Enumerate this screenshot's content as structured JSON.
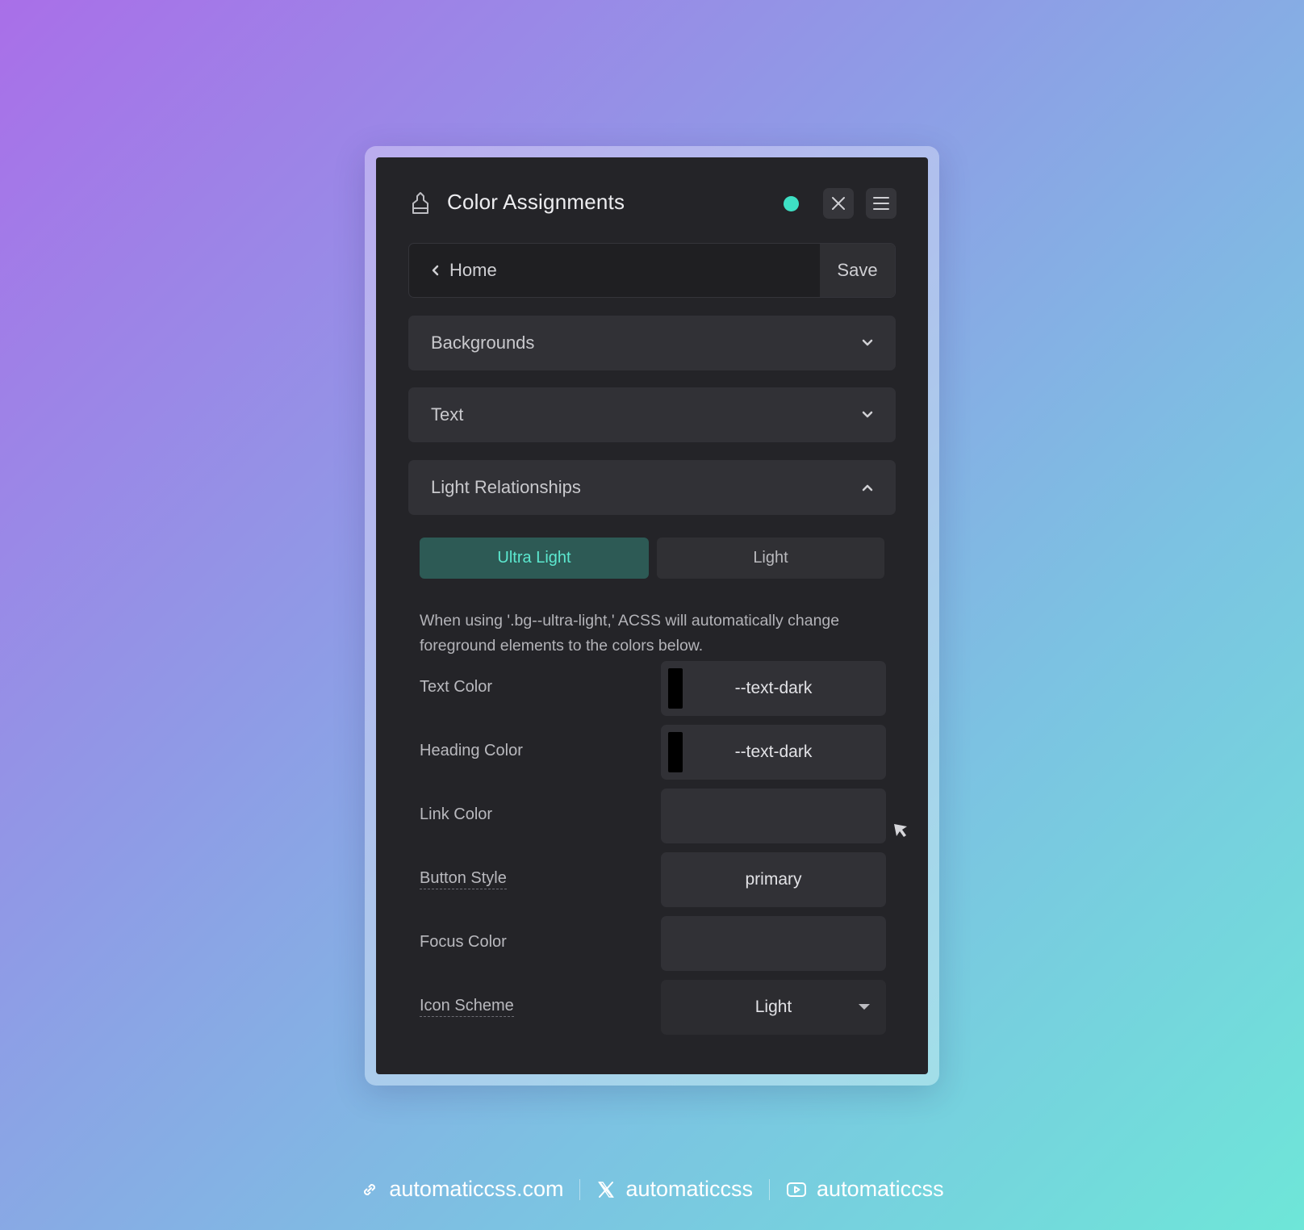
{
  "panel": {
    "title": "Color Assignments",
    "status_color": "#3ee0c4",
    "nav": {
      "back_label": "Home",
      "save_label": "Save"
    },
    "sections": [
      {
        "label": "Backgrounds",
        "state": "collapsed"
      },
      {
        "label": "Text",
        "state": "collapsed"
      },
      {
        "label": "Light Relationships",
        "state": "expanded"
      }
    ],
    "segments": {
      "active": "Ultra Light",
      "inactive": "Light"
    },
    "description": "When using '.bg--ultra-light,' ACSS will automatically change foreground elements to the colors below.",
    "rows": [
      {
        "label": "Text Color",
        "value": "--text-dark",
        "swatch": "#000000"
      },
      {
        "label": "Heading Color",
        "value": "--text-dark",
        "swatch": "#000000"
      },
      {
        "label": "Link Color",
        "value": ""
      },
      {
        "label": "Button Style",
        "value": "primary"
      },
      {
        "label": "Focus Color",
        "value": ""
      },
      {
        "label": "Icon Scheme",
        "value": "Light"
      }
    ]
  },
  "footer": {
    "website": "automaticcss.com",
    "x_handle": "automaticcss",
    "youtube_handle": "automaticcss"
  },
  "colors": {
    "accent": "#5ce8cf",
    "panel_bg": "#242428"
  }
}
